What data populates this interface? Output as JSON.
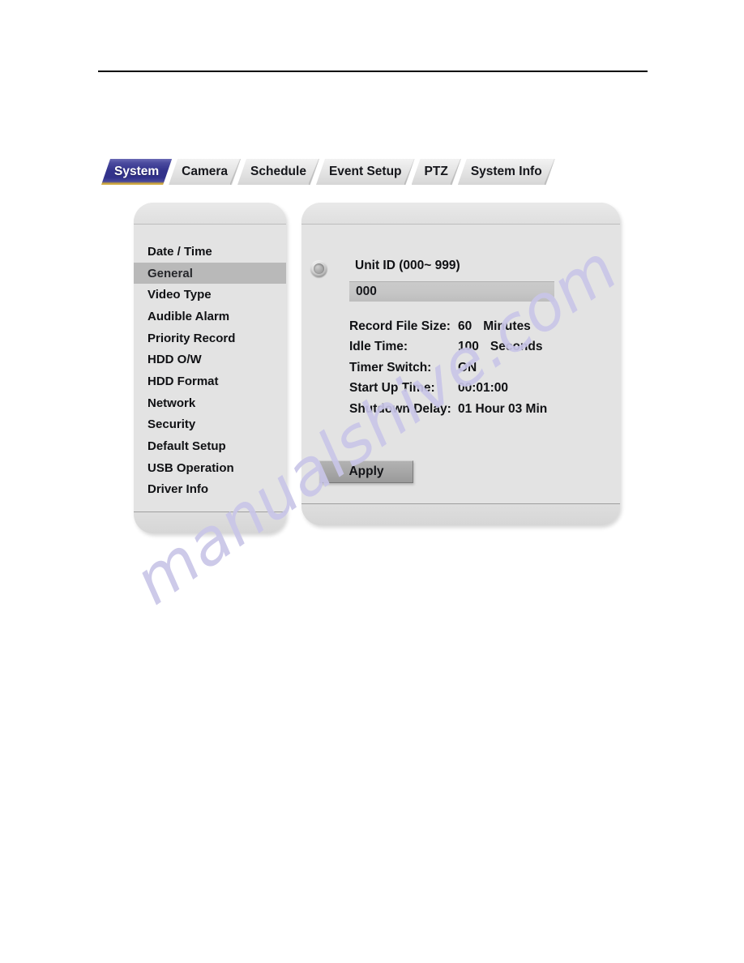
{
  "page": {
    "watermark": "manualshive.com"
  },
  "tabs": [
    {
      "label": "System",
      "active": true
    },
    {
      "label": "Camera",
      "active": false
    },
    {
      "label": "Schedule",
      "active": false
    },
    {
      "label": "Event Setup",
      "active": false
    },
    {
      "label": "PTZ",
      "active": false
    },
    {
      "label": "System Info",
      "active": false
    }
  ],
  "sidebar": {
    "items": [
      {
        "label": "Date / Time",
        "selected": false
      },
      {
        "label": "General",
        "selected": true
      },
      {
        "label": "Video Type",
        "selected": false
      },
      {
        "label": "Audible Alarm",
        "selected": false
      },
      {
        "label": "Priority Record",
        "selected": false
      },
      {
        "label": "HDD O/W",
        "selected": false
      },
      {
        "label": "HDD Format",
        "selected": false
      },
      {
        "label": "Network",
        "selected": false
      },
      {
        "label": "Security",
        "selected": false
      },
      {
        "label": "Default Setup",
        "selected": false
      },
      {
        "label": "USB Operation",
        "selected": false
      },
      {
        "label": "Driver Info",
        "selected": false
      }
    ]
  },
  "content": {
    "unit_id_label": "Unit ID (000~ 999)",
    "unit_id_value": "000",
    "settings": [
      {
        "label": "Record File Size:",
        "value": "60",
        "unit": "Minutes"
      },
      {
        "label": "Idle Time:",
        "value": "100",
        "unit": "Seconds"
      },
      {
        "label": "Timer Switch:",
        "value": "ON",
        "unit": ""
      },
      {
        "label": "Start Up Time:",
        "value": "00:01:00",
        "unit": ""
      },
      {
        "label": "Shutdown Delay:",
        "value": "01 Hour  03 Min",
        "unit": ""
      }
    ],
    "apply_label": "Apply"
  },
  "colors": {
    "active_tab": "#33338c",
    "active_tab_underline": "#c8a23c",
    "panel_bg": "#e3e3e3",
    "selected_item_bg": "#b9b9b9",
    "input_bg": "#c6c6c6",
    "watermark": "#c9c6e8"
  }
}
